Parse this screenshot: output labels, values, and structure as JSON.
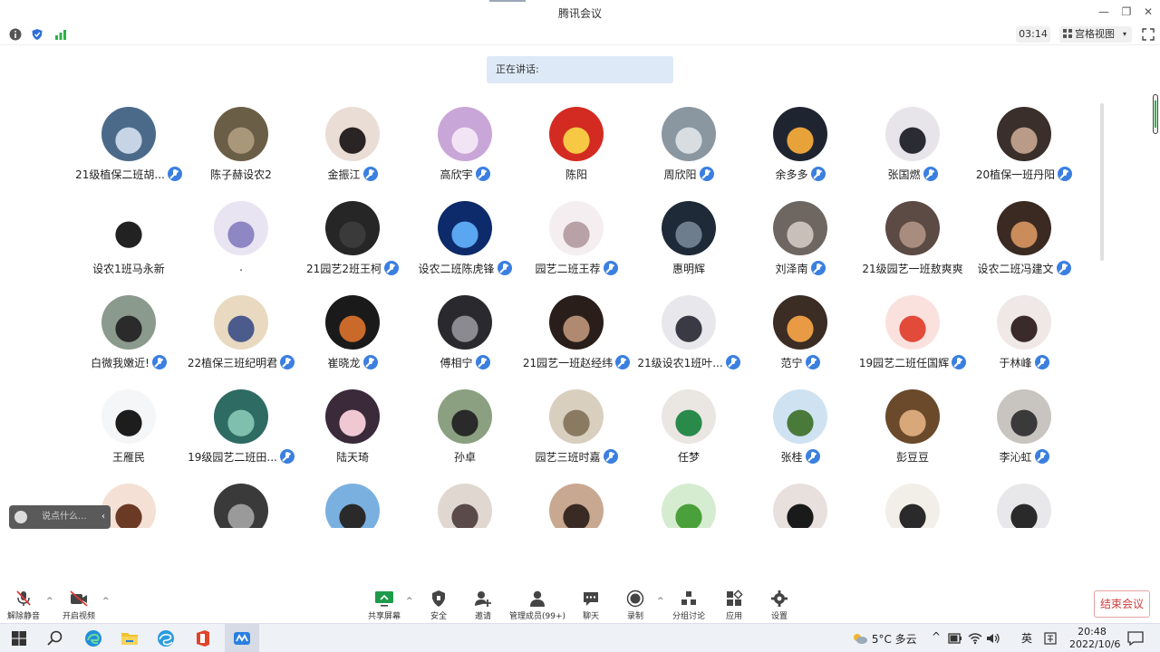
{
  "window": {
    "title": "腾讯会议",
    "minimize": "—",
    "restore": "❐",
    "close": "✕"
  },
  "infobar": {
    "timer": "03:14",
    "view_mode": "宫格视图",
    "view_caret": "▾"
  },
  "speaking": {
    "label": "正在讲话:"
  },
  "participants": [
    {
      "name": "21级植保二班胡...",
      "mic": true,
      "avatar": {
        "bg": "#4b6a8a",
        "fg": "#c6d4e6"
      }
    },
    {
      "name": "陈子赫设农2",
      "mic": false,
      "avatar": {
        "bg": "#6b5e46",
        "fg": "#a9977a"
      }
    },
    {
      "name": "金振江",
      "mic": true,
      "avatar": {
        "bg": "#e9ddd5",
        "fg": "#2a2424"
      }
    },
    {
      "name": "高欣宇",
      "mic": true,
      "avatar": {
        "bg": "#c9a6d8",
        "fg": "#f3e4f5"
      }
    },
    {
      "name": "陈阳",
      "mic": false,
      "avatar": {
        "bg": "#d32b22",
        "fg": "#f6c844"
      }
    },
    {
      "name": "周欣阳",
      "mic": true,
      "avatar": {
        "bg": "#8a96a0",
        "fg": "#d8dde2"
      }
    },
    {
      "name": "余多多",
      "mic": true,
      "avatar": {
        "bg": "#1f2530",
        "fg": "#e8a23a"
      }
    },
    {
      "name": "张国燃",
      "mic": true,
      "avatar": {
        "bg": "#e7e4ea",
        "fg": "#2b2b33"
      }
    },
    {
      "name": "20植保一班丹阳",
      "mic": true,
      "avatar": {
        "bg": "#3a2f2a",
        "fg": "#b99b88"
      }
    },
    {
      "name": "设农1班马永新",
      "mic": false,
      "avatar": {
        "bg": "#ffffff",
        "fg": "#222222"
      }
    },
    {
      "name": ".",
      "mic": false,
      "avatar": {
        "bg": "#e9e4f2",
        "fg": "#8f86c4"
      }
    },
    {
      "name": "21园艺2班王柯",
      "mic": true,
      "avatar": {
        "bg": "#262626",
        "fg": "#3a3a3a"
      }
    },
    {
      "name": "设农二班陈虎锋",
      "mic": true,
      "avatar": {
        "bg": "#0d2a6a",
        "fg": "#5aa6f0"
      }
    },
    {
      "name": "园艺二班王荐",
      "mic": true,
      "avatar": {
        "bg": "#f5eef0",
        "fg": "#b8a2a8"
      }
    },
    {
      "name": "惠明辉",
      "mic": false,
      "avatar": {
        "bg": "#1e2a38",
        "fg": "#6d7d8e"
      }
    },
    {
      "name": "刘泽南",
      "mic": true,
      "avatar": {
        "bg": "#6e6660",
        "fg": "#c8bfb8"
      }
    },
    {
      "name": "21级园艺一班敖爽爽",
      "mic": false,
      "avatar": {
        "bg": "#5c4a44",
        "fg": "#a88c7e"
      }
    },
    {
      "name": "设农二班冯建文",
      "mic": true,
      "avatar": {
        "bg": "#3b2a22",
        "fg": "#c98c5a"
      }
    },
    {
      "name": "白微我嫩近!",
      "mic": true,
      "avatar": {
        "bg": "#8a9a8c",
        "fg": "#2b2b2b"
      }
    },
    {
      "name": "22植保三班纪明君",
      "mic": true,
      "avatar": {
        "bg": "#e9d9c0",
        "fg": "#4b5c8c"
      }
    },
    {
      "name": "崔晓龙",
      "mic": true,
      "avatar": {
        "bg": "#1a1a1a",
        "fg": "#c96a2a"
      }
    },
    {
      "name": "傅相宁",
      "mic": true,
      "avatar": {
        "bg": "#2a2a2e",
        "fg": "#8a8a90"
      }
    },
    {
      "name": "21园艺一班赵经纬",
      "mic": true,
      "avatar": {
        "bg": "#2a1e1a",
        "fg": "#b08a70"
      }
    },
    {
      "name": "21级设农1班叶...",
      "mic": true,
      "avatar": {
        "bg": "#e8e8ec",
        "fg": "#3a3a44"
      }
    },
    {
      "name": "范宁",
      "mic": true,
      "avatar": {
        "bg": "#3b2c24",
        "fg": "#e89a44"
      }
    },
    {
      "name": "19园艺二班任国辉",
      "mic": true,
      "avatar": {
        "bg": "#fbe1de",
        "fg": "#e24a3a"
      }
    },
    {
      "name": "于林峰",
      "mic": true,
      "avatar": {
        "bg": "#efe8e6",
        "fg": "#3a2a2a"
      }
    },
    {
      "name": "王雁民",
      "mic": false,
      "avatar": {
        "bg": "#f4f6f8",
        "fg": "#1d1d1d"
      }
    },
    {
      "name": "19级园艺二班田...",
      "mic": true,
      "avatar": {
        "bg": "#2e6b62",
        "fg": "#7fbfae"
      }
    },
    {
      "name": "陆天琦",
      "mic": false,
      "avatar": {
        "bg": "#3a2a3a",
        "fg": "#f0c8d4"
      }
    },
    {
      "name": "孙卓",
      "mic": false,
      "avatar": {
        "bg": "#8aa080",
        "fg": "#2a2a2a"
      }
    },
    {
      "name": "园艺三班时嘉",
      "mic": true,
      "avatar": {
        "bg": "#d8cfbf",
        "fg": "#8a7a62"
      }
    },
    {
      "name": "任梦",
      "mic": false,
      "avatar": {
        "bg": "#eae6e2",
        "fg": "#2a8a4a"
      }
    },
    {
      "name": "张桂",
      "mic": true,
      "avatar": {
        "bg": "#cfe2f2",
        "fg": "#4a7a3a"
      }
    },
    {
      "name": "彭豆豆",
      "mic": false,
      "avatar": {
        "bg": "#6a4a2a",
        "fg": "#d8a87a"
      }
    },
    {
      "name": "李沁虹",
      "mic": true,
      "avatar": {
        "bg": "#c8c4c0",
        "fg": "#3a3a3a"
      }
    },
    {
      "name": "",
      "mic": false,
      "avatar": {
        "bg": "#f4e0d4",
        "fg": "#6a3a24"
      }
    },
    {
      "name": "",
      "mic": false,
      "avatar": {
        "bg": "#3a3a3a",
        "fg": "#9a9a9a"
      }
    },
    {
      "name": "",
      "mic": false,
      "avatar": {
        "bg": "#7ab0e0",
        "fg": "#2a2a2a"
      }
    },
    {
      "name": "",
      "mic": false,
      "avatar": {
        "bg": "#e0d8d0",
        "fg": "#5a4a4a"
      }
    },
    {
      "name": "",
      "mic": false,
      "avatar": {
        "bg": "#c8a890",
        "fg": "#3a2a24"
      }
    },
    {
      "name": "",
      "mic": false,
      "avatar": {
        "bg": "#d6ecd0",
        "fg": "#4aa03a"
      }
    },
    {
      "name": "",
      "mic": false,
      "avatar": {
        "bg": "#e8e0dc",
        "fg": "#1a1a1a"
      }
    },
    {
      "name": "",
      "mic": false,
      "avatar": {
        "bg": "#f2efe9",
        "fg": "#2a2a2a"
      }
    },
    {
      "name": "",
      "mic": false,
      "avatar": {
        "bg": "#e8e8ea",
        "fg": "#2a2a2a"
      }
    }
  ],
  "chat": {
    "placeholder": "说点什么...",
    "collapse": "‹"
  },
  "toolbar": {
    "unmute": "解除静音",
    "start_video": "开启视频",
    "share_screen": "共享屏幕",
    "security": "安全",
    "invite": "邀请",
    "members": "管理成员(99+)",
    "chat": "聊天",
    "record": "录制",
    "breakout": "分组讨论",
    "apps": "应用",
    "settings": "设置",
    "end_meeting": "结束会议",
    "caret": "^"
  },
  "taskbar": {
    "weather": "5°C 多云",
    "ime": "英",
    "time": "20:48",
    "date": "2022/10/6",
    "tray_up": "^"
  },
  "colors": {
    "accent": "#3b7fe0",
    "speaking_bg": "#dde9f7",
    "end_red": "#d03b3b",
    "green": "#2bb44a"
  }
}
